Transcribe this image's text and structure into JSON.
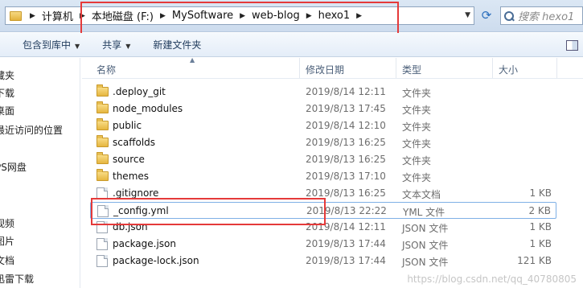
{
  "address_bar": {
    "crumbs": [
      "计算机",
      "本地磁盘 (F:)",
      "MySoftware",
      "web-blog",
      "hexo1"
    ],
    "search_placeholder": "搜索 hexo1"
  },
  "toolbar": {
    "include_in_library": "包含到库中",
    "share": "共享",
    "new_folder": "新建文件夹"
  },
  "nav": {
    "items": [
      "藏夹",
      "下载",
      "桌面",
      "最近访问的位置",
      "PS网盘",
      "视频",
      "图片",
      "文档",
      "迅雷下载"
    ]
  },
  "columns": {
    "name": "名称",
    "modified": "修改日期",
    "type": "类型",
    "size": "大小"
  },
  "files": [
    {
      "name": ".deploy_git",
      "modified": "2019/8/14 12:11",
      "type": "文件夹",
      "size": "",
      "icon": "folder-icon"
    },
    {
      "name": "node_modules",
      "modified": "2019/8/13 17:45",
      "type": "文件夹",
      "size": "",
      "icon": "folder-icon"
    },
    {
      "name": "public",
      "modified": "2019/8/14 12:10",
      "type": "文件夹",
      "size": "",
      "icon": "folder-icon"
    },
    {
      "name": "scaffolds",
      "modified": "2019/8/13 16:25",
      "type": "文件夹",
      "size": "",
      "icon": "folder-icon"
    },
    {
      "name": "source",
      "modified": "2019/8/13 16:25",
      "type": "文件夹",
      "size": "",
      "icon": "folder-icon"
    },
    {
      "name": "themes",
      "modified": "2019/8/13 17:10",
      "type": "文件夹",
      "size": "",
      "icon": "folder-icon"
    },
    {
      "name": ".gitignore",
      "modified": "2019/8/13 16:25",
      "type": "文本文档",
      "size": "1 KB",
      "icon": "file-icon"
    },
    {
      "name": "_config.yml",
      "modified": "2019/8/13 22:22",
      "type": "YML 文件",
      "size": "2 KB",
      "icon": "file-icon"
    },
    {
      "name": "db.json",
      "modified": "2019/8/14 12:11",
      "type": "JSON 文件",
      "size": "1 KB",
      "icon": "file-icon"
    },
    {
      "name": "package.json",
      "modified": "2019/8/13 17:44",
      "type": "JSON 文件",
      "size": "1 KB",
      "icon": "file-icon"
    },
    {
      "name": "package-lock.json",
      "modified": "2019/8/13 17:44",
      "type": "JSON 文件",
      "size": "121 KB",
      "icon": "file-icon"
    }
  ],
  "watermark": "https://blog.csdn.net/qq_40780805",
  "colors": {
    "highlight_box": "#e53a3a",
    "selection_border": "#7fb0e6"
  }
}
